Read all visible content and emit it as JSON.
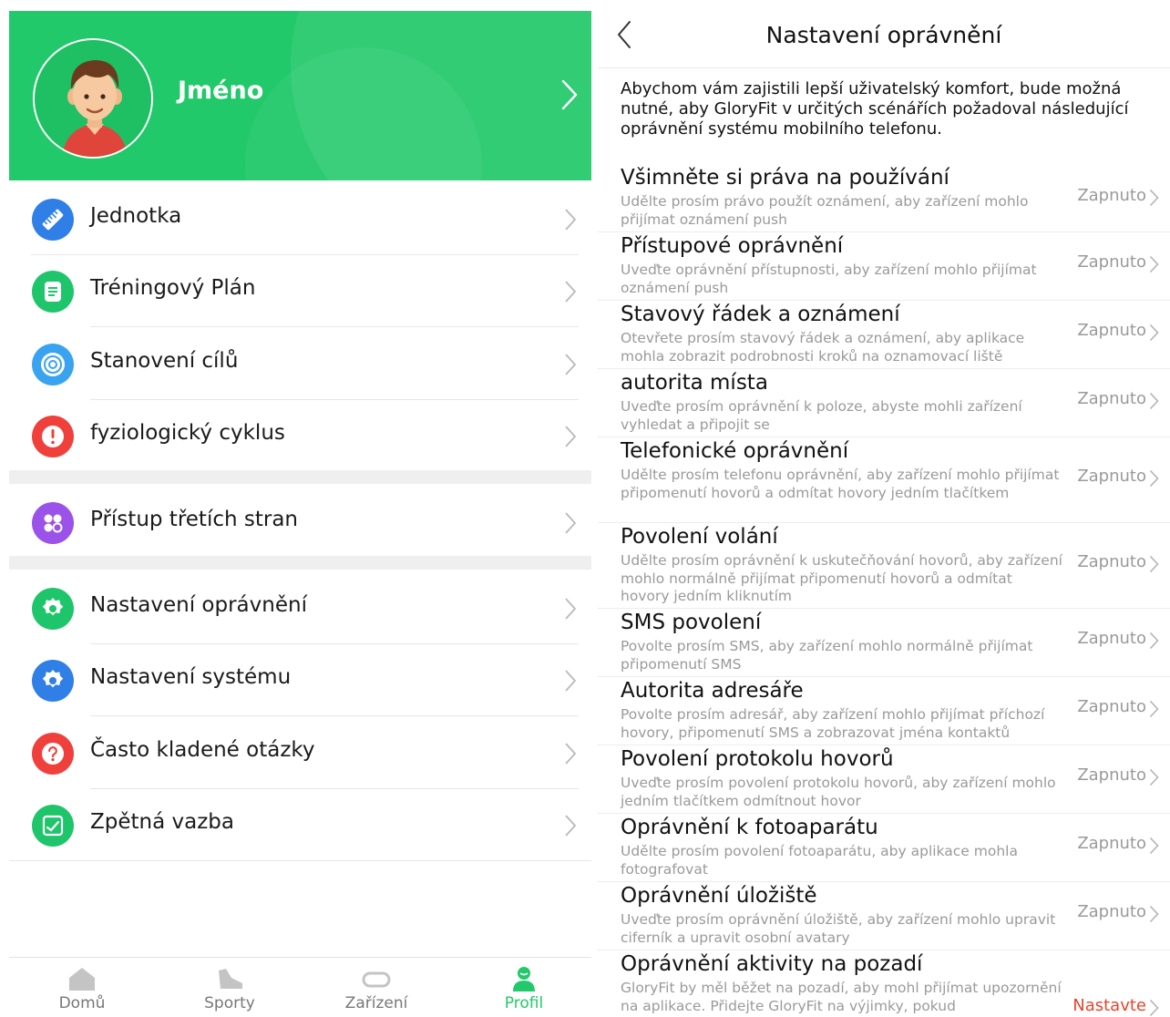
{
  "left": {
    "profile": {
      "name": "Jméno"
    },
    "menu": [
      {
        "label": "Jednotka",
        "icon": "ruler-icon",
        "color": "#2f7fe6"
      },
      {
        "label": "Tréningový Plán",
        "icon": "plan-icon",
        "color": "#1fc56a"
      },
      {
        "label": "Stanovení cílů",
        "icon": "target-icon",
        "color": "#3aa3f0"
      },
      {
        "label": "fyziologický cyklus",
        "icon": "alert-icon",
        "color": "#f0403c"
      },
      {
        "label": "Přístup třetích stran",
        "icon": "apps-icon",
        "color": "#9a52e8"
      },
      {
        "label": "Nastavení oprávnění",
        "icon": "gear-icon",
        "color": "#1fc56a"
      },
      {
        "label": "Nastavení systému",
        "icon": "gear-icon",
        "color": "#2f7fe6"
      },
      {
        "label": "Často kladené otázky",
        "icon": "question-icon",
        "color": "#f0403c"
      },
      {
        "label": "Zpětná vazba",
        "icon": "feedback-icon",
        "color": "#1fc56a"
      }
    ],
    "tabs": [
      {
        "label": "Domů",
        "icon": "home-icon"
      },
      {
        "label": "Sporty",
        "icon": "shoe-icon"
      },
      {
        "label": "Zařízení",
        "icon": "watch-icon"
      },
      {
        "label": "Profil",
        "icon": "profile-icon",
        "active": true
      }
    ],
    "accent": "#22c96a"
  },
  "right": {
    "title": "Nastavení oprávnění",
    "intro": "Abychom vám zajistili lepší uživatelský komfort, bude možná nutné, aby GloryFit v určitých scénářích požadoval následující oprávnění systému mobilního telefonu.",
    "permissions": [
      {
        "title": "Všimněte si práva na používání",
        "desc": "Udělte prosím právo použít oznámení, aby zařízení mohlo přijímat oznámení push",
        "status": "Zapnuto"
      },
      {
        "title": "Přístupové oprávnění",
        "desc": "Uveďte oprávnění přístupnosti, aby zařízení mohlo přijímat oznámení push",
        "status": "Zapnuto"
      },
      {
        "title": "Stavový řádek a oznámení",
        "desc": "Otevřete prosím stavový řádek a oznámení, aby aplikace mohla zobrazit podrobnosti kroků na oznamovací liště",
        "status": "Zapnuto"
      },
      {
        "title": "autorita místa",
        "desc": "Uveďte prosím oprávnění k poloze, abyste mohli zařízení vyhledat a připojit se",
        "status": "Zapnuto"
      },
      {
        "title": "Telefonické oprávnění",
        "desc": "Udělte prosím telefonu oprávnění, aby zařízení mohlo přijímat připomenutí hovorů a odmítat hovory jedním tlačítkem",
        "status": "Zapnuto"
      },
      {
        "title": "Povolení volání",
        "desc": "Udělte prosím oprávnění k uskutečňování hovorů, aby zařízení mohlo normálně přijímat připomenutí hovorů a odmítat hovory jedním kliknutím",
        "status": "Zapnuto"
      },
      {
        "title": "SMS povolení",
        "desc": "Povolte prosím SMS, aby zařízení mohlo normálně přijímat připomenutí SMS",
        "status": "Zapnuto"
      },
      {
        "title": "Autorita adresáře",
        "desc": "Povolte prosím adresář, aby zařízení mohlo přijímat příchozí hovory, připomenutí SMS a zobrazovat jména kontaktů",
        "status": "Zapnuto"
      },
      {
        "title": "Povolení protokolu hovorů",
        "desc": "Uveďte prosím povolení protokolu hovorů, aby zařízení mohlo jedním tlačítkem odmítnout hovor",
        "status": "Zapnuto"
      },
      {
        "title": "Oprávnění k fotoaparátu",
        "desc": "Udělte prosím povolení fotoaparátu, aby aplikace mohla fotografovat",
        "status": "Zapnuto"
      },
      {
        "title": "Oprávnění úložiště",
        "desc": "Uveďte prosím oprávnění úložiště, aby zařízení mohlo upravit ciferník a upravit osobní avatary",
        "status": "Zapnuto"
      },
      {
        "title": "Oprávnění aktivity na pozadí",
        "desc": "GloryFit by měl běžet na pozadí, aby mohl přijímat upozornění na aplikace. Přidejte GloryFit na výjimky, pokud",
        "status": "Nastavte",
        "status_color": "#e8452c"
      }
    ]
  }
}
